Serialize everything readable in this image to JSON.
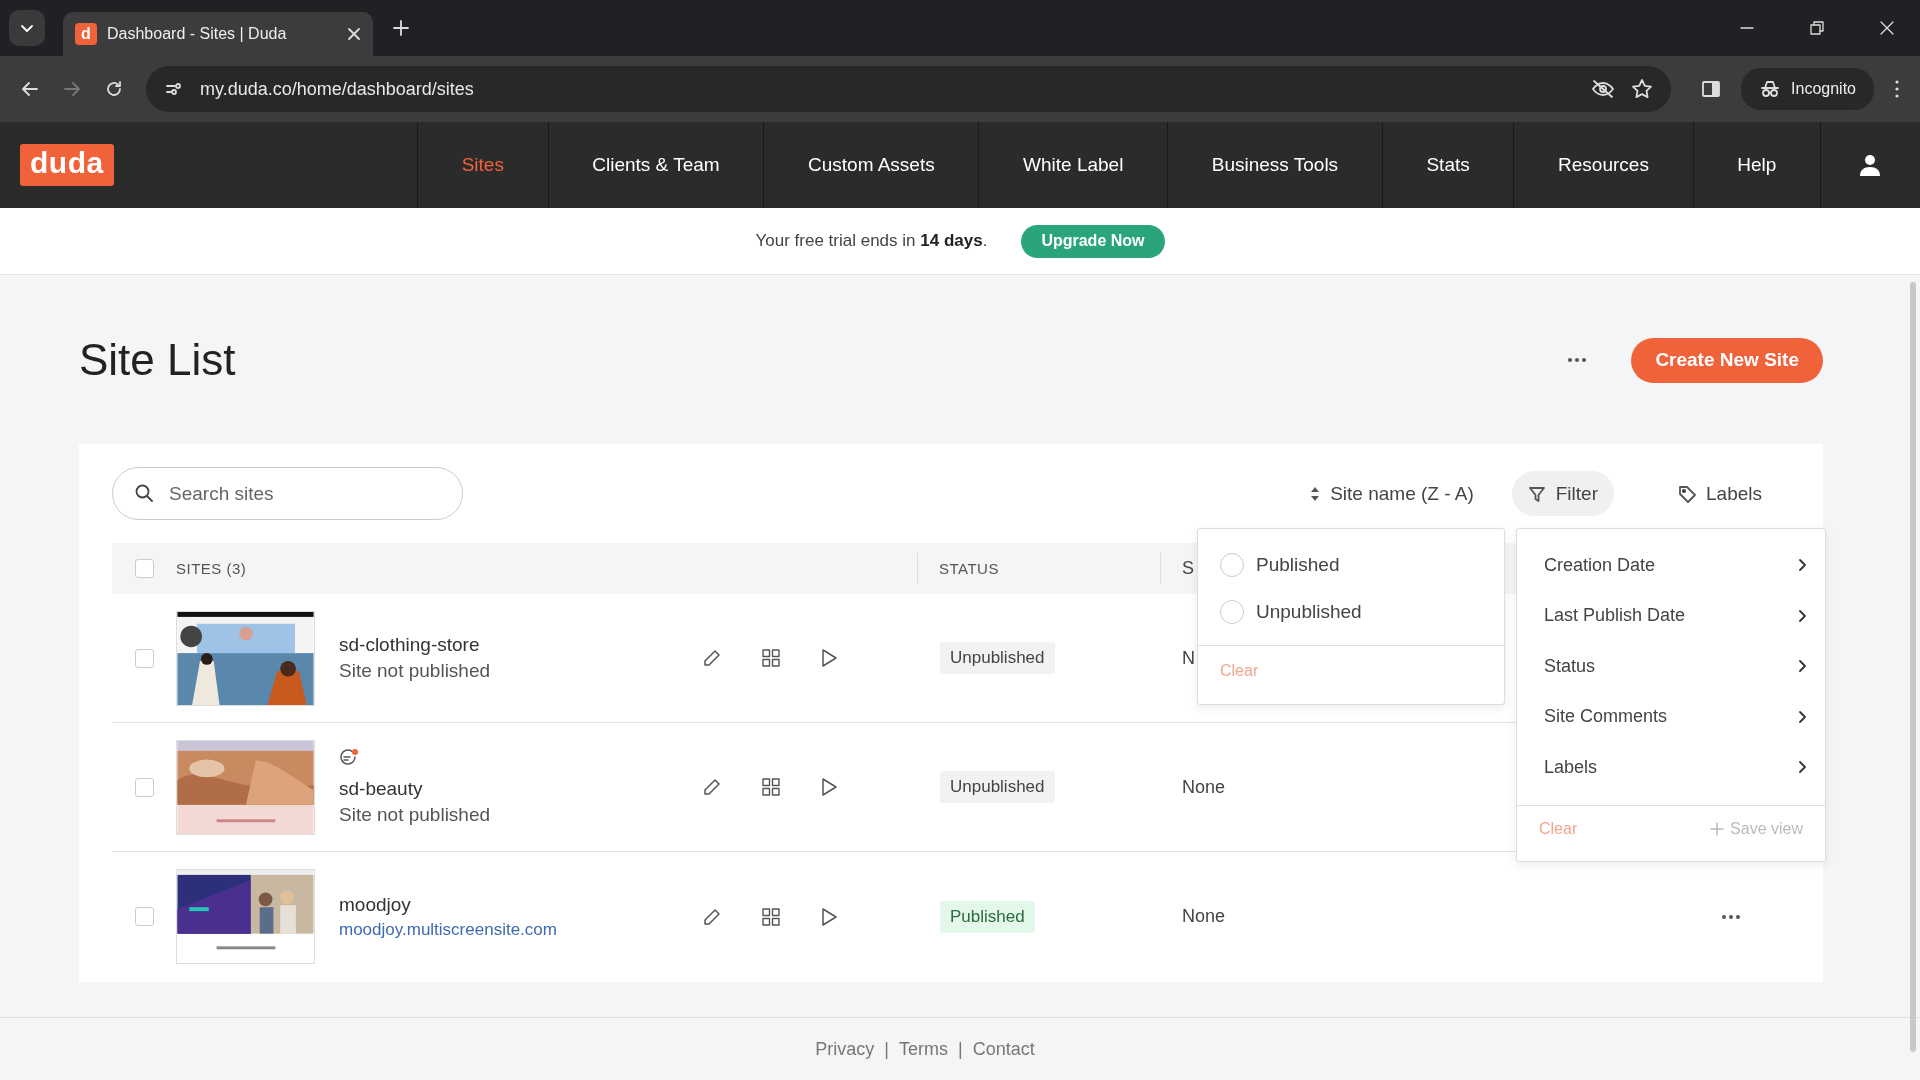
{
  "browser": {
    "tab_title": "Dashboard - Sites | Duda",
    "tab_favicon": "d",
    "url": "my.duda.co/home/dashboard/sites",
    "profile": "Incognito"
  },
  "app_nav": {
    "logo": "duda",
    "items": [
      {
        "label": "Sites",
        "selected": true
      },
      {
        "label": "Clients & Team",
        "selected": false
      },
      {
        "label": "Custom Assets",
        "selected": false
      },
      {
        "label": "White Label",
        "selected": false
      },
      {
        "label": "Business Tools",
        "selected": false
      },
      {
        "label": "Stats",
        "selected": false
      },
      {
        "label": "Resources",
        "selected": false
      },
      {
        "label": "Help",
        "selected": false
      }
    ]
  },
  "trial_banner": {
    "text": "Your free trial ends in **14 days**.",
    "button": "Upgrade Now"
  },
  "page": {
    "title": "Site List",
    "create_button": "Create New Site"
  },
  "toolbar": {
    "search_placeholder": "Search sites",
    "sort": "Site name (Z - A)",
    "filter": {
      "label": "Filter",
      "selected": true
    },
    "labels": "Labels"
  },
  "table": {
    "columns": [
      "SITES (3)",
      "STATUS",
      "S"
    ],
    "header_checked": false,
    "rows": [
      {
        "name": "sd-clothing-store",
        "subtitle": "Site not published",
        "subtitle_link": false,
        "status": "Unpublished",
        "published": false,
        "column_3": "N",
        "has_comment": false,
        "has_menu": false,
        "checked": false
      },
      {
        "name": "sd-beauty",
        "subtitle": "Site not published",
        "subtitle_link": false,
        "status": "Unpublished",
        "published": false,
        "column_3": "None",
        "has_comment": true,
        "has_menu": false,
        "checked": false
      },
      {
        "name": "moodjoy",
        "subtitle": "moodjoy.multiscreensite.com",
        "subtitle_link": true,
        "status": "Published",
        "published": true,
        "column_3": "None",
        "has_comment": false,
        "has_menu": true,
        "checked": false
      }
    ]
  },
  "status_popup": {
    "options": [
      {
        "label": "Published",
        "selected": false
      },
      {
        "label": "Unpublished",
        "selected": false
      }
    ],
    "clear": "Clear"
  },
  "filter_menu": {
    "items": [
      "Creation Date",
      "Last Publish Date",
      "Status",
      "Site Comments",
      "Labels"
    ],
    "clear": "Clear",
    "save": "Save view"
  },
  "footer": {
    "links": [
      "Privacy",
      "Terms",
      "Contact"
    ],
    "separator": "|"
  }
}
